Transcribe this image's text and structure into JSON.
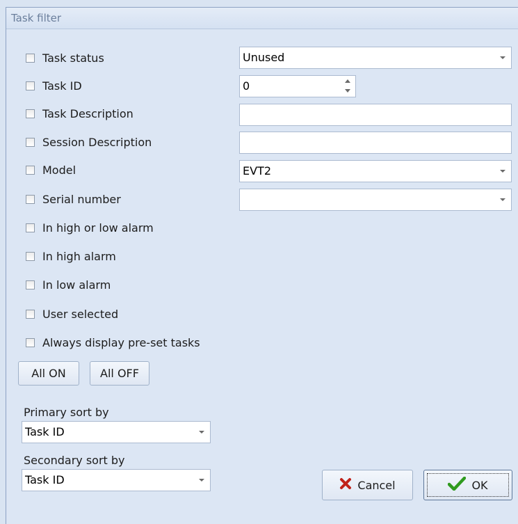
{
  "window": {
    "title": "Task filter"
  },
  "filters": [
    {
      "label": "Task status",
      "checked": false
    },
    {
      "label": "Task ID",
      "checked": false
    },
    {
      "label": "Task Description",
      "checked": false
    },
    {
      "label": "Session Description",
      "checked": false
    },
    {
      "label": "Model",
      "checked": false
    },
    {
      "label": "Serial number",
      "checked": false
    },
    {
      "label": "In high or low alarm",
      "checked": false
    },
    {
      "label": "In high alarm",
      "checked": false
    },
    {
      "label": "In low alarm",
      "checked": false
    },
    {
      "label": "User selected",
      "checked": false
    },
    {
      "label": "Always display pre-set tasks",
      "checked": false
    }
  ],
  "inputs": {
    "task_status": "Unused",
    "task_id": "0",
    "task_description": "",
    "session_description": "",
    "model": "EVT2",
    "serial_number": ""
  },
  "buttons": {
    "all_on": "All ON",
    "all_off": "All OFF",
    "cancel": "Cancel",
    "ok": "OK"
  },
  "sort": {
    "primary_label": "Primary sort by",
    "primary_value": "Task ID",
    "secondary_label": "Secondary sort by",
    "secondary_value": "Task ID"
  },
  "icons": {
    "cancel": "red-x-icon",
    "ok": "green-check-icon"
  },
  "colors": {
    "cancel_icon": "#c0221a",
    "ok_icon": "#2f9a1e"
  }
}
